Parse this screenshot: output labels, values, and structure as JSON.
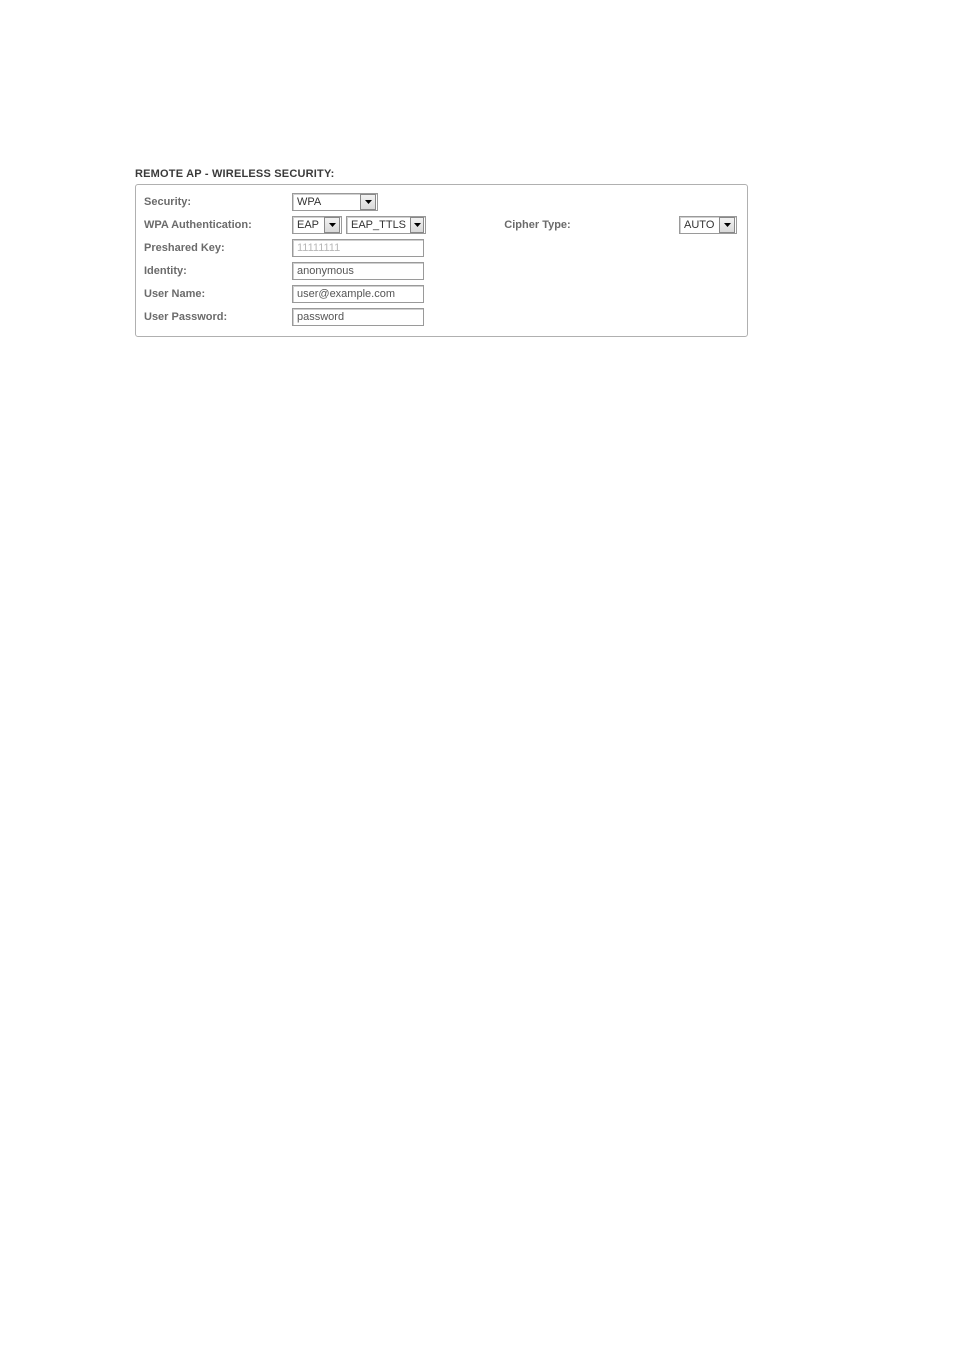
{
  "section_title": "REMOTE AP - WIRELESS SECURITY:",
  "labels": {
    "security": "Security:",
    "wpa_auth": "WPA Authentication:",
    "cipher_type": "Cipher Type:",
    "preshared_key": "Preshared Key:",
    "identity": "Identity:",
    "user_name": "User Name:",
    "user_password": "User Password:"
  },
  "fields": {
    "security": {
      "value": "WPA"
    },
    "wpa_auth_primary": {
      "value": "EAP"
    },
    "wpa_auth_secondary": {
      "value": "EAP_TTLS"
    },
    "cipher_type": {
      "value": "AUTO"
    },
    "preshared_key": {
      "value": "11111111",
      "enabled": false
    },
    "identity": {
      "value": "anonymous"
    },
    "user_name": {
      "value": "user@example.com"
    },
    "user_password": {
      "value": "password"
    }
  }
}
